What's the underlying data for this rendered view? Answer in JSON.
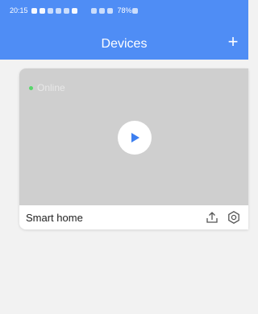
{
  "status_bar": {
    "time": "20:15",
    "battery": "78%"
  },
  "header": {
    "title": "Devices",
    "add_label": "+"
  },
  "device_card": {
    "status": "Online",
    "name": "Smart home"
  },
  "colors": {
    "header_bg": "#4f8df5",
    "play_accent": "#3d7ff0",
    "online_dot": "#57d66a",
    "preview_bg": "#cfcfcf"
  },
  "icons": [
    "play-icon",
    "share-icon",
    "settings-icon",
    "add-icon"
  ]
}
